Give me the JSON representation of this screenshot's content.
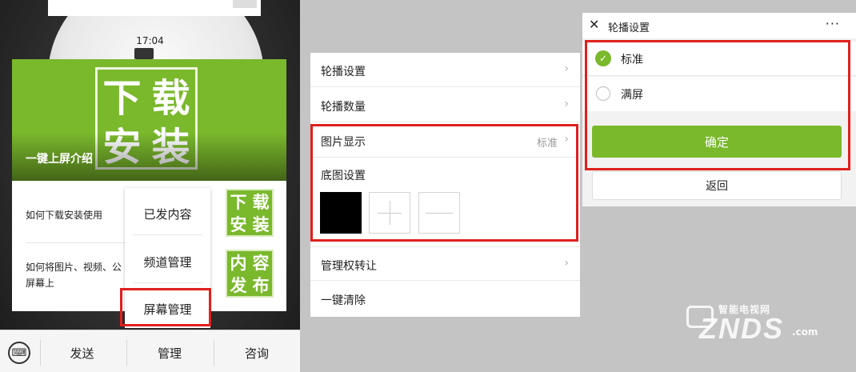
{
  "left_panel": {
    "status_time": "17:04",
    "banner_logo_chars": [
      "下",
      "载",
      "安",
      "装"
    ],
    "banner_caption": "一键上屏介绍",
    "list_items": [
      {
        "line1": "如何下载安装使用",
        "line2": ""
      },
      {
        "line1": "如何将图片、视频、公",
        "line2": "屏幕上"
      }
    ],
    "mini_logo_1": [
      "下",
      "载",
      "安",
      "装"
    ],
    "mini_logo_2": [
      "内",
      "容",
      "发",
      "布"
    ],
    "popup_menu": [
      "已发内容",
      "频道管理",
      "屏幕管理"
    ],
    "bottom_bar": {
      "keyboard_glyph": "⌨",
      "send": "发送",
      "manage": "管理",
      "consult": "咨询"
    }
  },
  "middle_panel": {
    "items": [
      {
        "label": "轮播设置",
        "value": ""
      },
      {
        "label": "轮播数量",
        "value": ""
      },
      {
        "label": "图片显示",
        "value": "标准"
      }
    ],
    "bg_setting_label": "底图设置",
    "transfer_admin": "管理权转让",
    "clear_all": "一键清除",
    "chevron": "›"
  },
  "right_panel": {
    "close_glyph": "✕",
    "title": "轮播设置",
    "more_glyph": "···",
    "options": [
      {
        "label": "标准",
        "selected": true
      },
      {
        "label": "满屏",
        "selected": false
      }
    ],
    "check_glyph": "✓",
    "confirm": "确定",
    "back": "返回"
  },
  "watermark": {
    "small": "智能电视网",
    "big": "ZNDS",
    "suffix": ".com"
  },
  "colors": {
    "accent_green": "#7ab82c",
    "highlight_red": "#e0201e"
  }
}
